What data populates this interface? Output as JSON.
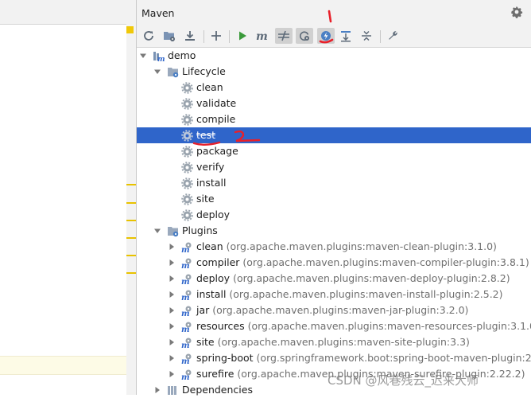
{
  "panel": {
    "title": "Maven"
  },
  "toolbar": {
    "buttons": [
      {
        "name": "reload-all-icon",
        "tip": "Reload All Maven Projects"
      },
      {
        "name": "generate-sources-icon",
        "tip": "Generate Sources and Update Folders"
      },
      {
        "name": "download-icon",
        "tip": "Download Sources and/or Documentation"
      },
      {
        "name": "add-project-icon",
        "tip": "Add Maven Projects"
      },
      {
        "name": "run-icon",
        "tip": "Run Maven Build"
      },
      {
        "name": "execute-goal-icon",
        "tip": "Execute Maven Goal"
      },
      {
        "name": "toggle-offline-icon",
        "tip": "Toggle Offline Mode"
      },
      {
        "name": "always-update-snapshots-icon",
        "tip": "Always Update Snapshots"
      },
      {
        "name": "skip-tests-icon",
        "tip": "Toggle 'Skip Tests' Mode"
      },
      {
        "name": "show-dependencies-icon",
        "tip": "Show Dependencies"
      },
      {
        "name": "collapse-all-icon",
        "tip": "Collapse All"
      },
      {
        "name": "settings-wrench-icon",
        "tip": "Maven Settings"
      }
    ]
  },
  "tree": {
    "project": "demo",
    "lifecycle": {
      "label": "Lifecycle",
      "goals": [
        "clean",
        "validate",
        "compile",
        "test",
        "package",
        "verify",
        "install",
        "site",
        "deploy"
      ],
      "selected": "test",
      "skipped": "test"
    },
    "plugins": {
      "label": "Plugins",
      "items": [
        {
          "name": "clean",
          "detail": "(org.apache.maven.plugins:maven-clean-plugin:3.1.0)"
        },
        {
          "name": "compiler",
          "detail": "(org.apache.maven.plugins:maven-compiler-plugin:3.8.1)"
        },
        {
          "name": "deploy",
          "detail": "(org.apache.maven.plugins:maven-deploy-plugin:2.8.2)"
        },
        {
          "name": "install",
          "detail": "(org.apache.maven.plugins:maven-install-plugin:2.5.2)"
        },
        {
          "name": "jar",
          "detail": "(org.apache.maven.plugins:maven-jar-plugin:3.2.0)"
        },
        {
          "name": "resources",
          "detail": "(org.apache.maven.plugins:maven-resources-plugin:3.1.0)"
        },
        {
          "name": "site",
          "detail": "(org.apache.maven.plugins:maven-site-plugin:3.3)"
        },
        {
          "name": "spring-boot",
          "detail": "(org.springframework.boot:spring-boot-maven-plugin:2.3.7"
        },
        {
          "name": "surefire",
          "detail": "(org.apache.maven.plugins:maven-surefire-plugin:2.22.2)"
        }
      ]
    },
    "dependencies": {
      "label": "Dependencies"
    }
  },
  "annotations": {
    "mark_1": "1",
    "mark_2": "2"
  },
  "watermark": "CSDN @风巷残云_迟来大师",
  "colors": {
    "selection": "#2f65ca",
    "annotation": "#e8202a",
    "run_green": "#3a9a3a",
    "folder_blue": "#7a93b4"
  }
}
